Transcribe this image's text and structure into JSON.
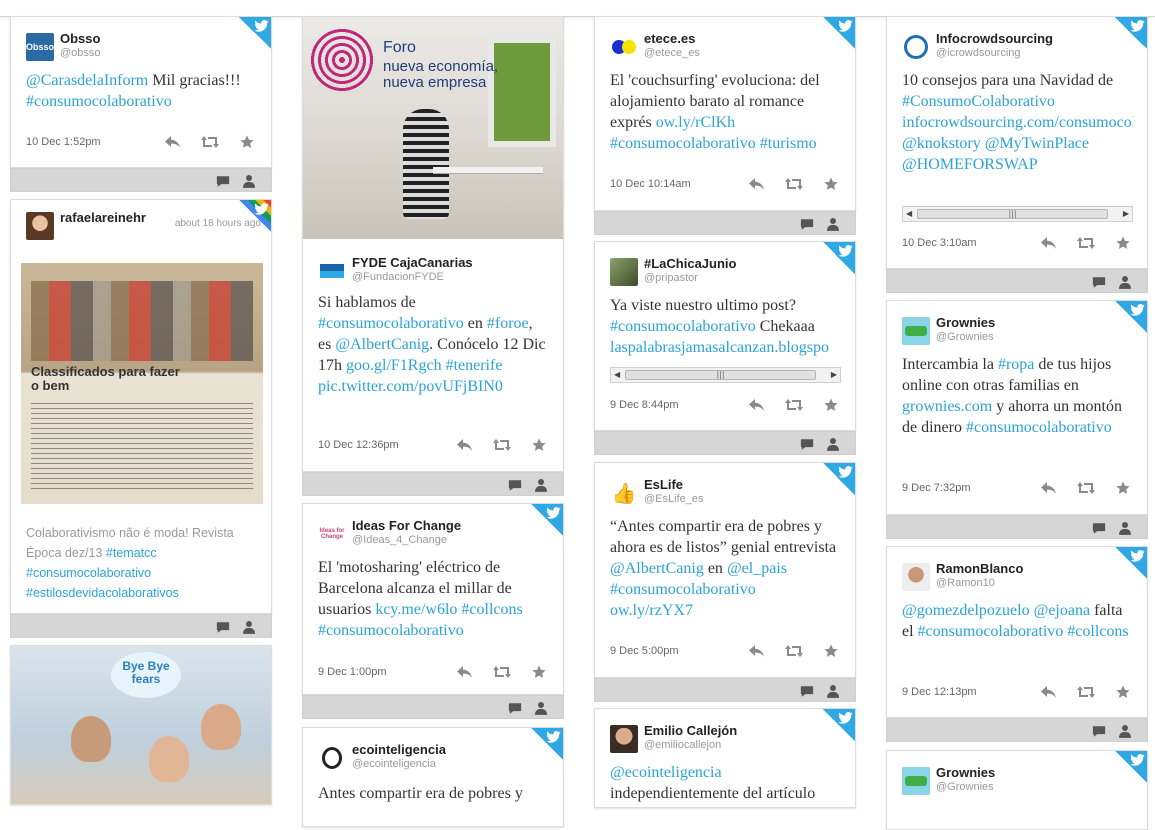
{
  "icons": {
    "reply": "reply-icon",
    "retweet": "retweet-icon",
    "favorite": "star-icon",
    "comment": "comment-icon",
    "user": "user-icon",
    "twitter": "twitter-bird-icon"
  },
  "colors": {
    "link": "#2aa3d8",
    "twitter_blue": "#2fa8e6",
    "strip": "#d6d6d6"
  },
  "col1": [
    {
      "name": "Obsso",
      "handle": "@obsso",
      "text_parts": [
        {
          "t": "@CarasdelaInform",
          "link": true
        },
        {
          "t": " Mil gracias!!! ",
          "link": false
        },
        {
          "t": "#consumocolaborativo",
          "link": true
        }
      ],
      "date": "10 Dec 1:52pm"
    },
    {
      "name": "rafaelareinehr",
      "ago": "about 18 hours ago",
      "image_heading": "Classificados para fazer o bem",
      "text_parts": [
        {
          "t": "Colaborativismo não é moda! Revista Época dez/13 ",
          "link": false
        },
        {
          "t": "#tematcc",
          "link": true
        },
        {
          "t": " ",
          "link": false
        },
        {
          "t": "#consumocolaborativo",
          "link": true
        },
        {
          "t": " ",
          "link": false
        },
        {
          "t": "#estilosdevidacolaborativos",
          "link": true
        }
      ]
    },
    {
      "image_sign": "Bye Bye fears"
    }
  ],
  "col2": [
    {
      "poster_title": "Foro",
      "poster_sub1": "nueva economía,",
      "poster_sub2": "nueva empresa",
      "name": "FYDE CajaCanarias",
      "handle": "@FundacionFYDE",
      "text_parts": [
        {
          "t": "Si hablamos de ",
          "link": false
        },
        {
          "t": "#consumocolaborativo",
          "link": true
        },
        {
          "t": " en ",
          "link": false
        },
        {
          "t": "#foroe",
          "link": true
        },
        {
          "t": ", es ",
          "link": false
        },
        {
          "t": "@AlbertCanig",
          "link": true
        },
        {
          "t": ". Conócelo 12 Dic 17h ",
          "link": false
        },
        {
          "t": "goo.gl/F1Rgch",
          "link": true
        },
        {
          "t": " ",
          "link": false
        },
        {
          "t": "#tenerife",
          "link": true
        },
        {
          "t": " ",
          "link": false
        },
        {
          "t": "pic.twitter.com/povUFjBIN0",
          "link": true
        }
      ],
      "date": "10 Dec 12:36pm"
    },
    {
      "name": "Ideas For Change",
      "handle": "@Ideas_4_Change",
      "logo_text": "Ideas for Change",
      "text_parts": [
        {
          "t": "El 'motosharing' eléctrico de Barcelona alcanza el millar de usuarios ",
          "link": false
        },
        {
          "t": "kcy.me/w6lo",
          "link": true
        },
        {
          "t": " ",
          "link": false
        },
        {
          "t": "#collcons",
          "link": true
        },
        {
          "t": " ",
          "link": false
        },
        {
          "t": "#consumocolaborativo",
          "link": true
        }
      ],
      "date": "9 Dec 1:00pm"
    },
    {
      "name": "ecointeligencia",
      "handle": "@ecointeligencia",
      "text_parts": [
        {
          "t": "Antes compartir era de pobres y",
          "link": false
        }
      ]
    }
  ],
  "col3": [
    {
      "name": "etece.es",
      "handle": "@etece_es",
      "text_parts": [
        {
          "t": "El 'couchsurfing' evoluciona: del alojamiento barato al romance exprés ",
          "link": false
        },
        {
          "t": "ow.ly/rClKh",
          "link": true
        },
        {
          "t": " ",
          "link": false
        },
        {
          "t": "#consumocolaborativo",
          "link": true
        },
        {
          "t": " ",
          "link": false
        },
        {
          "t": "#turismo",
          "link": true
        }
      ],
      "date": "10 Dec 10:14am"
    },
    {
      "name": "#LaChicaJunio",
      "handle": "@pripastor",
      "text_parts": [
        {
          "t": "Ya viste nuestro ultimo post? ",
          "link": false
        },
        {
          "t": "#consumocolaborativo",
          "link": true
        },
        {
          "t": " Chekaaa ",
          "link": false
        },
        {
          "t": "laspalabrasjamasalcanzan.blogspo",
          "link": true
        }
      ],
      "date": "9 Dec 8:44pm"
    },
    {
      "name": "EsLife",
      "handle": "@EsLife_es",
      "text_parts": [
        {
          "t": "“Antes compartir era de pobres y ahora es de listos” genial entrevista ",
          "link": false
        },
        {
          "t": "@AlbertCanig",
          "link": true
        },
        {
          "t": " en ",
          "link": false
        },
        {
          "t": "@el_pais",
          "link": true
        },
        {
          "t": " ",
          "link": false
        },
        {
          "t": "#consumocolaborativo",
          "link": true
        },
        {
          "t": " ",
          "link": false
        },
        {
          "t": "ow.ly/rzYX7",
          "link": true
        }
      ],
      "date": "9 Dec 5:00pm"
    },
    {
      "name": "Emilio Callejón",
      "handle": "@emiliocallejon",
      "text_parts": [
        {
          "t": "@ecointeligencia",
          "link": true
        },
        {
          "t": " independientemente del artículo",
          "link": false
        }
      ]
    }
  ],
  "col4": [
    {
      "name": "Infocrowdsourcing",
      "handle": "@icrowdsourcing",
      "text_parts": [
        {
          "t": "10 consejos para una Navidad de ",
          "link": false
        },
        {
          "t": "#ConsumoColaborativo",
          "link": true
        },
        {
          "t": " ",
          "link": false
        },
        {
          "t": "infocrowdsourcing.com/consumocolabo...",
          "link": true
        },
        {
          "t": " ",
          "link": false
        },
        {
          "t": "@knokstory",
          "link": true
        },
        {
          "t": " ",
          "link": false
        },
        {
          "t": "@MyTwinPlace",
          "link": true
        },
        {
          "t": " ",
          "link": false
        },
        {
          "t": "@HOMEFORSWAP",
          "link": true
        }
      ],
      "date": "10 Dec 3:10am"
    },
    {
      "name": "Grownies",
      "handle": "@Grownies",
      "text_parts": [
        {
          "t": "Intercambia la ",
          "link": false
        },
        {
          "t": "#ropa",
          "link": true
        },
        {
          "t": " de tus hijos online con otras familias en ",
          "link": false
        },
        {
          "t": "grownies.com",
          "link": true
        },
        {
          "t": " y ahorra un montón de dinero ",
          "link": false
        },
        {
          "t": "#consumocolaborativo",
          "link": true
        }
      ],
      "date": "9 Dec 7:32pm"
    },
    {
      "name": "RamonBlanco",
      "handle": "@Ramon10",
      "text_parts": [
        {
          "t": "@gomezdelpozuelo",
          "link": true
        },
        {
          "t": " ",
          "link": false
        },
        {
          "t": "@ejoana",
          "link": true
        },
        {
          "t": " falta el ",
          "link": false
        },
        {
          "t": "#consumocolaborativo",
          "link": true
        },
        {
          "t": " ",
          "link": false
        },
        {
          "t": "#collcons",
          "link": true
        }
      ],
      "date": "9 Dec 12:13pm"
    },
    {
      "name": "Grownies",
      "handle": "@Grownies"
    }
  ]
}
